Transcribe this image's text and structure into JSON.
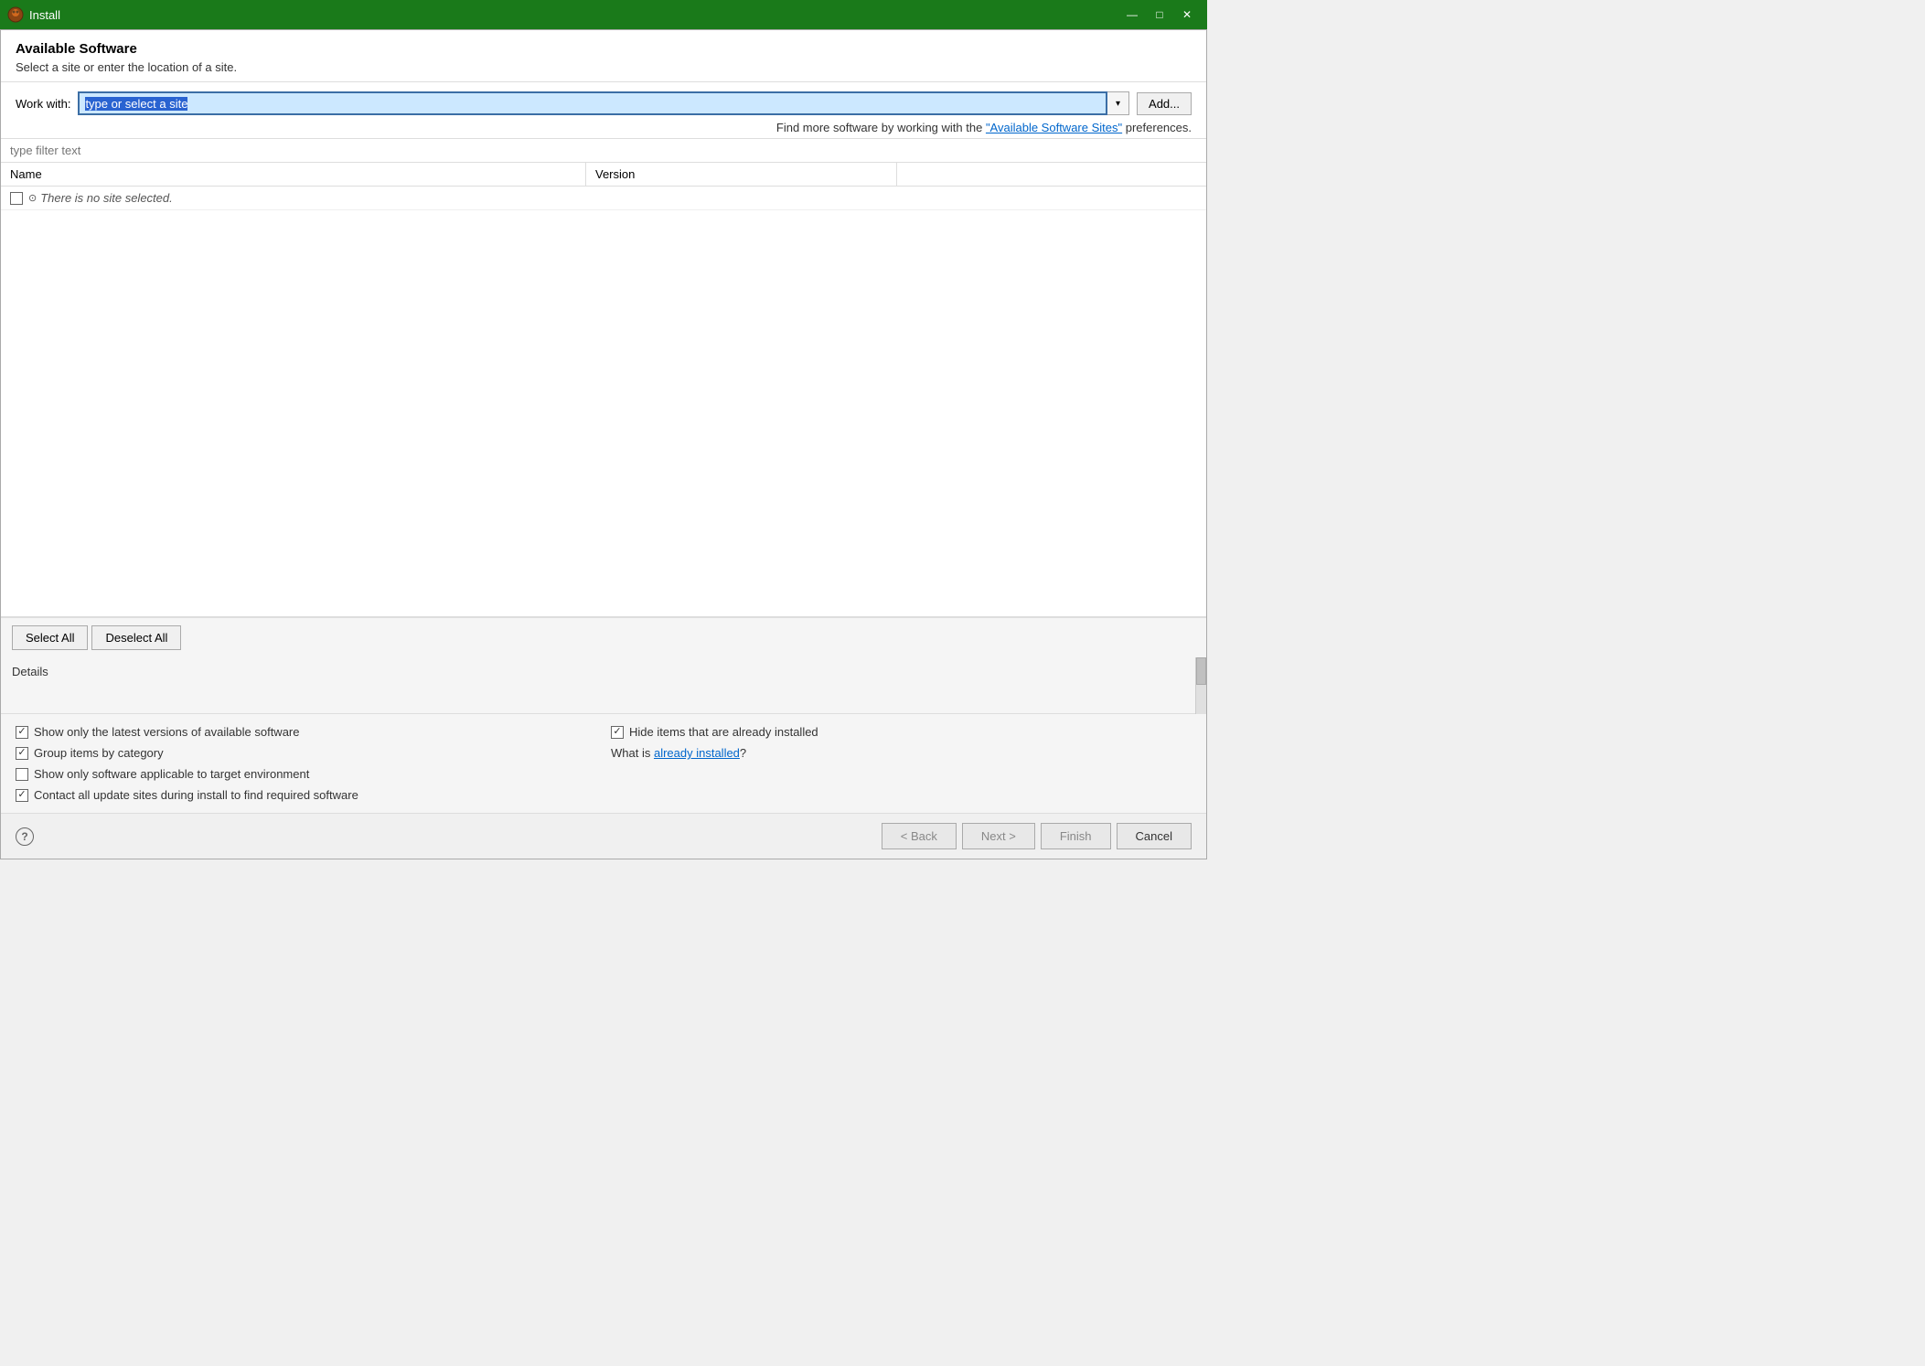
{
  "titleBar": {
    "title": "Install",
    "minimize": "—",
    "maximize": "□",
    "close": "✕"
  },
  "header": {
    "title": "Available Software",
    "subtitle": "Select a site or enter the location of a site."
  },
  "workWith": {
    "label": "Work with:",
    "placeholder": "type or select a site",
    "addButton": "Add...",
    "findMoreText": "Find more software by working with the ",
    "findMoreLink": "\"Available Software Sites\"",
    "findMoreSuffix": " preferences."
  },
  "filter": {
    "placeholder": "type filter text"
  },
  "table": {
    "columns": [
      "Name",
      "Version"
    ],
    "noSiteMessage": "There is no site selected."
  },
  "buttons": {
    "selectAll": "Select All",
    "deselectAll": "Deselect All"
  },
  "details": {
    "label": "Details"
  },
  "options": {
    "left": [
      {
        "label": "Show only the latest versions of available software",
        "checked": true
      },
      {
        "label": "Group items by category",
        "checked": true
      },
      {
        "label": "Show only software applicable to target environment",
        "checked": false
      },
      {
        "label": "Contact all update sites during install to find required software",
        "checked": true
      }
    ],
    "right": [
      {
        "label": "Hide items that are already installed",
        "checked": true
      },
      {
        "label": "What is ",
        "link": "already installed",
        "suffix": "?",
        "checked": null
      }
    ]
  },
  "footer": {
    "help": "?",
    "backButton": "< Back",
    "nextButton": "Next >",
    "finishButton": "Finish",
    "cancelButton": "Cancel"
  }
}
